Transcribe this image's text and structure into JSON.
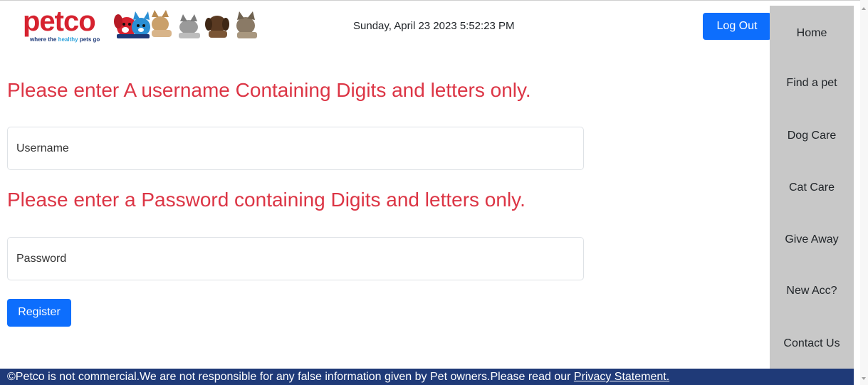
{
  "header": {
    "logo": {
      "wordmark": "petco",
      "tagline_before": "where the ",
      "tagline_highlight": "healthy",
      "tagline_after": " pets go"
    },
    "datetime": "Sunday, April 23 2023 5:52:23 PM",
    "logout_label": "Log Out"
  },
  "sidebar": {
    "items": [
      {
        "label": "Home"
      },
      {
        "label": "Find a pet"
      },
      {
        "label": "Dog Care"
      },
      {
        "label": "Cat Care"
      },
      {
        "label": "Give Away"
      },
      {
        "label": "New Acc?"
      },
      {
        "label": "Contact Us"
      }
    ]
  },
  "form": {
    "username_heading": "Please enter A username Containing Digits and letters only.",
    "username_placeholder": "Username",
    "password_heading": "Please enter a Password containing Digits and letters only.",
    "password_placeholder": "Password",
    "register_label": "Register"
  },
  "footer": {
    "text": "©Petco is not commercial.We are not responsible for any false information given by Pet owners.Please read our ",
    "link_label": "Privacy Statement."
  },
  "colors": {
    "brand_red": "#d6222f",
    "brand_navy": "#1f3a78",
    "accent_blue": "#0d6efd",
    "heading_red": "#dc3545",
    "sidebar_gray": "#c8c8c8"
  },
  "icons": [
    "petco-mascot-logo",
    "pets-group-image"
  ]
}
